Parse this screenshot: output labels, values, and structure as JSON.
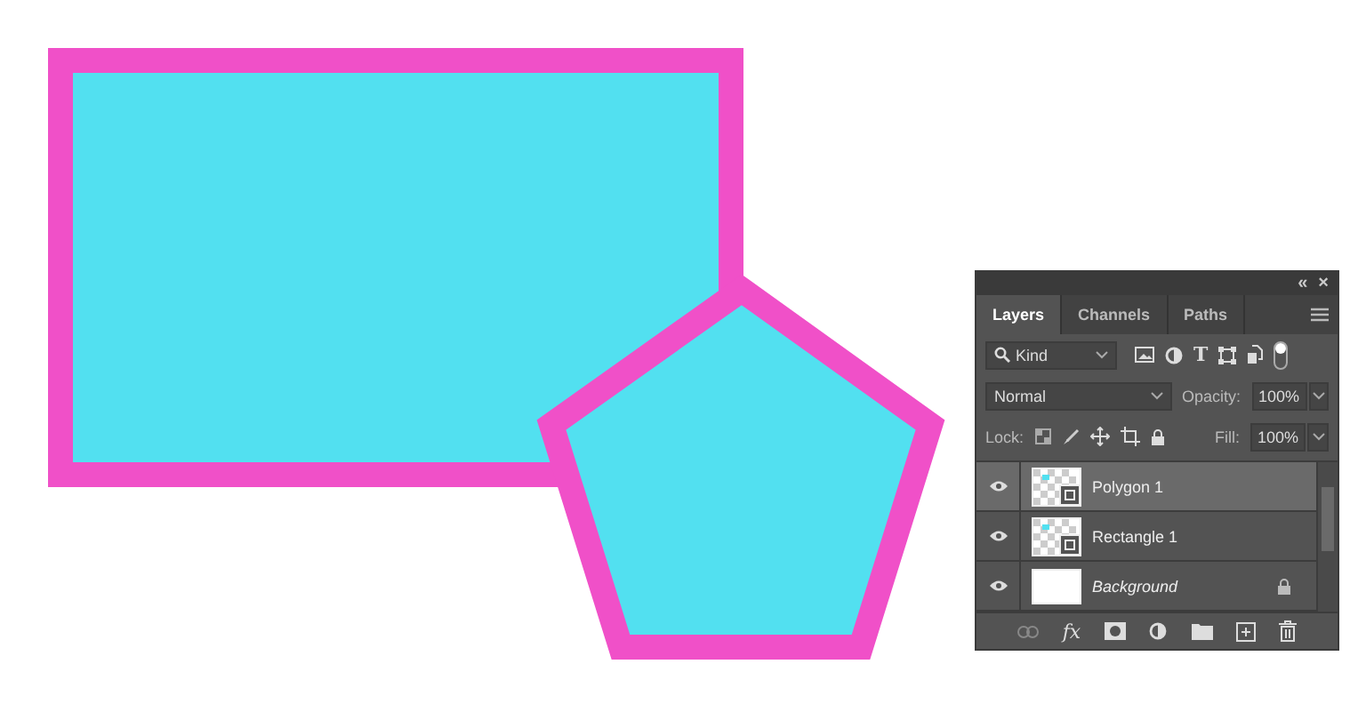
{
  "canvas": {
    "shapes": [
      {
        "kind": "rectangle"
      },
      {
        "kind": "pentagon"
      }
    ]
  },
  "panel": {
    "header_glyphs": [
      "«",
      "×"
    ],
    "type_glyph": "T",
    "effects_glyph": "fx",
    "tabs": [
      {
        "label": "Layers",
        "selected": true
      },
      {
        "label": "Channels",
        "selected": false
      },
      {
        "label": "Paths",
        "selected": false
      }
    ],
    "filter": {
      "value": "Kind"
    },
    "blend_mode": {
      "value": "Normal"
    },
    "opacity": {
      "label": "Opacity:",
      "value": "100%"
    },
    "lock": {
      "label": "Lock:"
    },
    "fill": {
      "label": "Fill:",
      "value": "100%"
    },
    "layers": [
      {
        "name": "Polygon 1",
        "kind": "shape",
        "selected": true,
        "visible": true,
        "locked": false
      },
      {
        "name": "Rectangle 1",
        "kind": "shape",
        "selected": false,
        "visible": true,
        "locked": false
      },
      {
        "name": "Background",
        "kind": "background",
        "selected": false,
        "visible": true,
        "locked": true
      }
    ]
  }
}
